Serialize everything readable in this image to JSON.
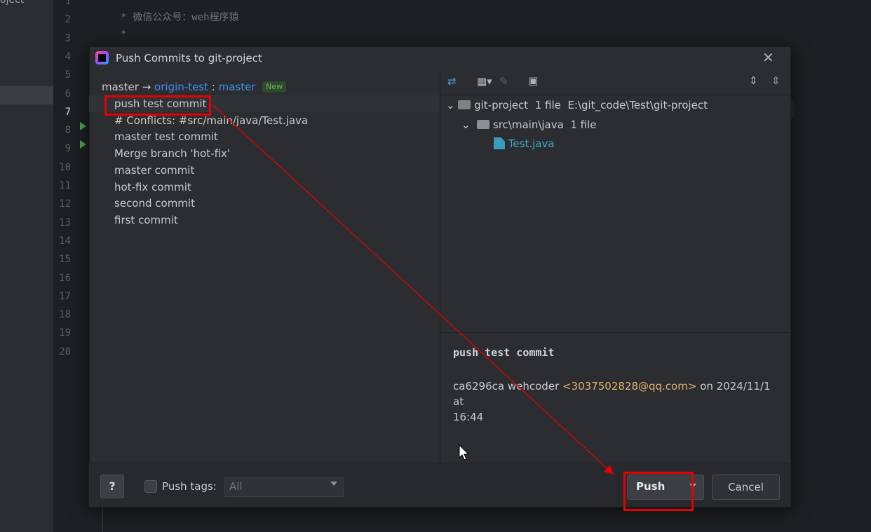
{
  "ide": {
    "project_label": "oject",
    "line_numbers": [
      "1",
      "2",
      "3",
      "4",
      "5",
      "6",
      "7",
      "8",
      "9",
      "10",
      "11",
      "12",
      "13",
      "14",
      "15",
      "16",
      "17",
      "18",
      "19",
      "20"
    ],
    "current_line": "7",
    "code_line_2": " * 微信公众号：weh程序猿",
    "code_line_3": " *"
  },
  "dialog": {
    "title": "Push Commits to git-project",
    "close_icon": "close-icon",
    "branch": {
      "local": "master",
      "arrow": "→",
      "remote": "origin-test",
      "colon": " : ",
      "remote_branch": "master",
      "badge": "New"
    },
    "commits": [
      "push test commit",
      "# Conflicts: #src/main/java/Test.java",
      "master test commit",
      "Merge branch 'hot-fix'",
      "master commit",
      "hot-fix commit",
      "second commit",
      "first commit"
    ],
    "toolbar_icons": [
      "expand-collapse-icon",
      "group-by-icon",
      "edit-icon",
      "preview-icon",
      "expand-all-icon",
      "collapse-all-icon"
    ],
    "tree": {
      "root_name": "git-project",
      "root_count": "1 file",
      "root_path": "E:\\git_code\\Test\\git-project",
      "folder_name": "src\\main\\java",
      "folder_count": "1 file",
      "file_name": "Test.java"
    },
    "details": {
      "title": "push test commit",
      "hash": "ca6296ca",
      "author": "wehcoder",
      "email": "<3037502828@qq.com>",
      "on": "on",
      "date": "2024/11/1 at",
      "time": "16:44"
    },
    "footer": {
      "help": "?",
      "push_tags_label": "Push tags:",
      "push_tags_value": "All",
      "push_button": "Push",
      "cancel_button": "Cancel"
    }
  },
  "colors": {
    "annotation": "#e60000",
    "link": "#3d8ff0",
    "email": "#e0b36f"
  }
}
